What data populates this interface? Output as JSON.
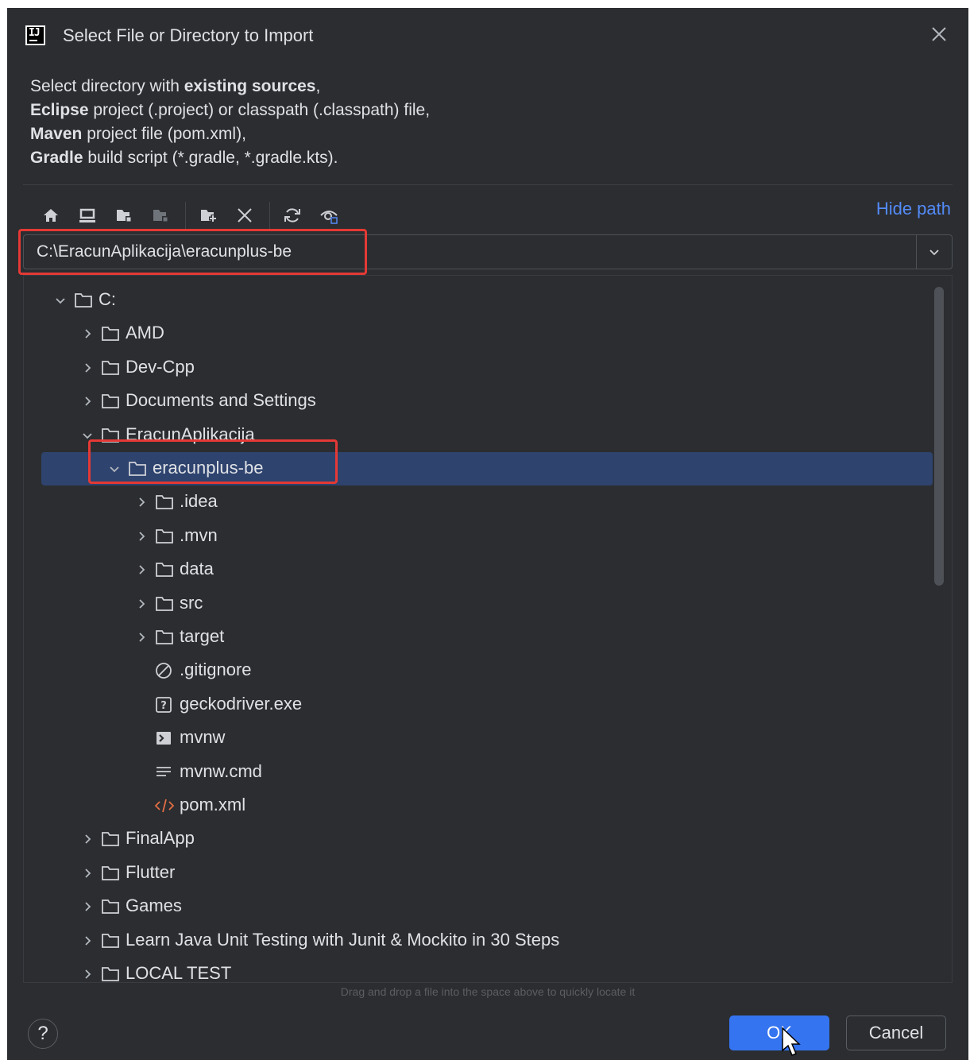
{
  "window": {
    "app_logo_text": "IJ",
    "title": "Select File or Directory to Import"
  },
  "description": [
    {
      "bold": "",
      "text": "Select directory with "
    },
    {
      "bold": "existing sources",
      "text": ","
    },
    {
      "bold": "Eclipse",
      "text": " project (.project) or classpath (.classpath) file,"
    },
    {
      "bold": "Maven",
      "text": " project file (pom.xml),"
    },
    {
      "bold": "Gradle",
      "text": " build script (*.gradle, *.gradle.kts)."
    }
  ],
  "toolbar": {
    "icons": [
      "home-icon",
      "desktop-icon",
      "project-directory-icon",
      "module-directory-icon",
      "new-folder-icon",
      "delete-icon",
      "refresh-icon",
      "show-hidden-files-icon"
    ],
    "hide_path_label": "Hide path"
  },
  "path": {
    "value": "C:\\EracunAplikacija\\eracunplus-be"
  },
  "tree": {
    "rows": [
      {
        "label": "C:",
        "level": 0,
        "expanded": true,
        "type": "folder"
      },
      {
        "label": "AMD",
        "level": 1,
        "expanded": false,
        "type": "folder"
      },
      {
        "label": "Dev-Cpp",
        "level": 1,
        "expanded": false,
        "type": "folder"
      },
      {
        "label": "Documents and Settings",
        "level": 1,
        "expanded": false,
        "type": "folder"
      },
      {
        "label": "EracunAplikacija",
        "level": 1,
        "expanded": true,
        "type": "folder"
      },
      {
        "label": "eracunplus-be",
        "level": 2,
        "expanded": true,
        "type": "folder",
        "selected": true
      },
      {
        "label": ".idea",
        "level": 3,
        "expanded": false,
        "type": "folder"
      },
      {
        "label": ".mvn",
        "level": 3,
        "expanded": false,
        "type": "folder"
      },
      {
        "label": "data",
        "level": 3,
        "expanded": false,
        "type": "folder"
      },
      {
        "label": "src",
        "level": 3,
        "expanded": false,
        "type": "folder"
      },
      {
        "label": "target",
        "level": 3,
        "expanded": false,
        "type": "folder"
      },
      {
        "label": ".gitignore",
        "level": 3,
        "type": "ignore-file"
      },
      {
        "label": "geckodriver.exe",
        "level": 3,
        "type": "unknown-file"
      },
      {
        "label": "mvnw",
        "level": 3,
        "type": "shell-file"
      },
      {
        "label": "mvnw.cmd",
        "level": 3,
        "type": "text-file"
      },
      {
        "label": "pom.xml",
        "level": 3,
        "type": "xml-file"
      },
      {
        "label": "FinalApp",
        "level": 1,
        "expanded": false,
        "type": "folder"
      },
      {
        "label": "Flutter",
        "level": 1,
        "expanded": false,
        "type": "folder"
      },
      {
        "label": "Games",
        "level": 1,
        "expanded": false,
        "type": "folder"
      },
      {
        "label": "Learn Java Unit Testing with Junit & Mockito in 30 Steps",
        "level": 1,
        "expanded": false,
        "type": "folder"
      },
      {
        "label": "LOCAL TEST",
        "level": 1,
        "expanded": false,
        "type": "folder"
      }
    ]
  },
  "drag_hint": "Drag and drop a file into the space above to quickly locate it",
  "footer": {
    "help_label": "?",
    "ok_label": "OK",
    "cancel_label": "Cancel"
  },
  "colors": {
    "background": "#2b2d30",
    "selection": "#2e436e",
    "accent": "#3574f0",
    "link": "#548af7",
    "highlight_box": "#e53935"
  }
}
